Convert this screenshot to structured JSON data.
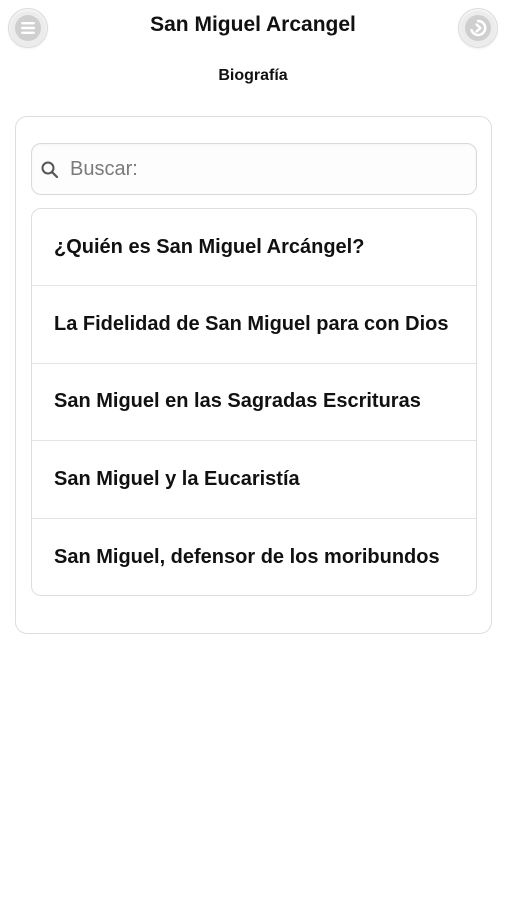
{
  "header": {
    "title": "San Miguel Arcangel",
    "subtitle": "Biografía",
    "menu_icon": "menu-icon",
    "back_icon": "back-arrow-icon"
  },
  "search": {
    "placeholder": "Buscar:",
    "icon": "search-icon"
  },
  "list": {
    "items": [
      {
        "label": "¿Quién es San Miguel Arcángel?"
      },
      {
        "label": "La Fidelidad de San Miguel para con Dios"
      },
      {
        "label": "San Miguel en las Sagradas Escrituras"
      },
      {
        "label": "San Miguel y la Eucaristía"
      },
      {
        "label": "San Miguel, defensor de los moribundos"
      }
    ]
  },
  "colors": {
    "background": "#ffffff",
    "text": "#111111",
    "border": "#dedede",
    "button": "#ececec"
  }
}
